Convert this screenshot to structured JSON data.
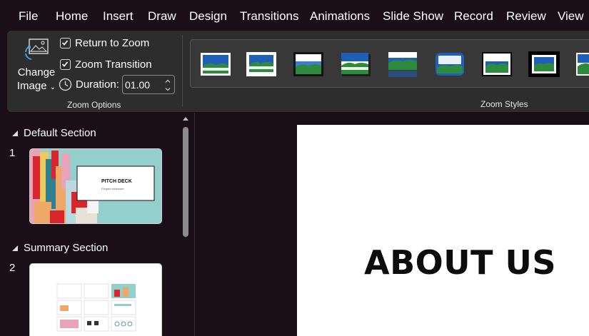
{
  "menu": [
    "File",
    "Home",
    "Insert",
    "Draw",
    "Design",
    "Transitions",
    "Animations",
    "Slide Show",
    "Record",
    "Review",
    "View"
  ],
  "ribbon": {
    "change_image": {
      "line1": "Change",
      "line2": "Image",
      "icon": "change-image-icon"
    },
    "return_to_zoom": {
      "label": "Return to Zoom",
      "checked": true
    },
    "zoom_transition": {
      "label": "Zoom Transition",
      "checked": true
    },
    "duration": {
      "label": "Duration:",
      "value": "01.00"
    },
    "zoom_options_label": "Zoom Options",
    "zoom_styles_label": "Zoom Styles"
  },
  "panel": {
    "sections": [
      {
        "name": "Default Section",
        "slides": [
          {
            "number": "1",
            "title": "PITCH DECK",
            "subtitle": "Elegant slideware"
          }
        ]
      },
      {
        "name": "Summary Section",
        "slides": [
          {
            "number": "2"
          }
        ]
      }
    ]
  },
  "slide": {
    "title": "ABOUT US"
  },
  "colors": {
    "accent_green": "#2e8b3e",
    "accent_blue": "#1f5fb8",
    "teal": "#95cfcb",
    "red": "#d9262d"
  }
}
